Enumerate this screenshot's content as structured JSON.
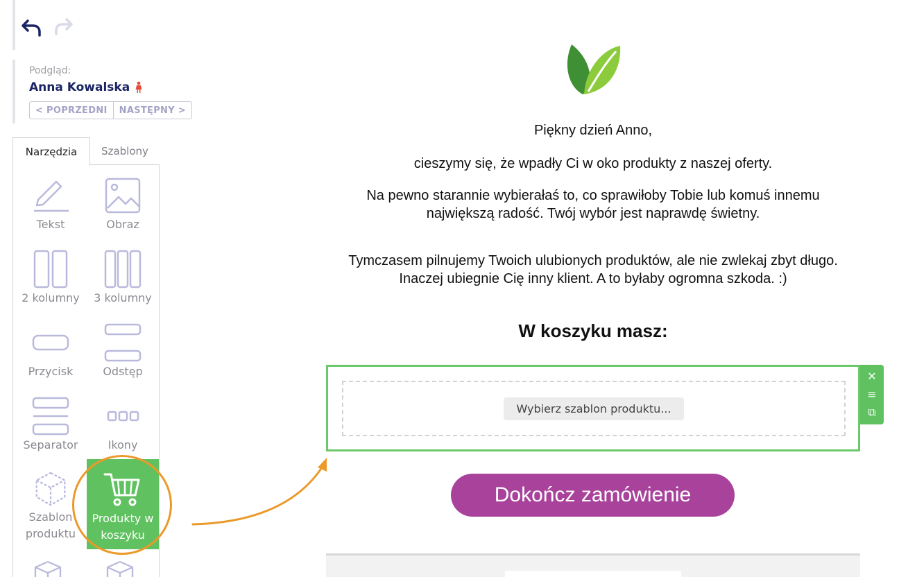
{
  "toolbar": {
    "undo_icon": "undo-icon",
    "redo_icon": "redo-icon"
  },
  "preview": {
    "label": "Podgląd:",
    "recipient": "Anna Kowalska",
    "prev_label": "< POPRZEDNI",
    "next_label": "NASTĘPNY >"
  },
  "tabs": {
    "tools": "Narzędzia",
    "templates": "Szablony"
  },
  "tools": [
    {
      "id": "text",
      "label": "Tekst",
      "icon": "pencil-icon"
    },
    {
      "id": "image",
      "label": "Obraz",
      "icon": "image-icon"
    },
    {
      "id": "two-columns",
      "label": "2 kolumny",
      "icon": "two-columns-icon"
    },
    {
      "id": "three-columns",
      "label": "3 kolumny",
      "icon": "three-columns-icon"
    },
    {
      "id": "button",
      "label": "Przycisk",
      "icon": "button-icon"
    },
    {
      "id": "spacer",
      "label": "Odstęp",
      "icon": "spacer-icon"
    },
    {
      "id": "separator",
      "label": "Separator",
      "icon": "separator-icon"
    },
    {
      "id": "icons",
      "label": "Ikony",
      "icon": "icons-icon"
    },
    {
      "id": "product-template",
      "label": "Szablon produktu",
      "icon": "box-icon"
    },
    {
      "id": "cart-products",
      "label": "Produkty w koszyku",
      "icon": "cart-icon"
    }
  ],
  "email": {
    "greeting": "Piękny dzień Anno,",
    "line1": "cieszymy się, że wpadły Ci w oko produkty z naszej oferty.",
    "line2a": "Na pewno starannie wybierałaś to, co sprawiłoby Tobie lub komuś innemu",
    "line2b": "największą radość. Twój wybór jest naprawdę świetny.",
    "line3a": "Tymczasem pilnujemy Twoich ulubionych produktów, ale nie zwlekaj zbyt długo.",
    "line3b": "Inaczej ubiegnie Cię inny klient. A to byłaby ogromna szkoda. :)",
    "cart_heading": "W koszyku masz:",
    "product_select": "Wybierz szablon produktu...",
    "cta": "Dokończ zamówienie"
  },
  "block_actions": {
    "close": "✕",
    "menu": "≡",
    "copy": "⧉"
  },
  "colors": {
    "accent_green": "#5fc15f",
    "cta_purple": "#a8429b",
    "highlight_orange": "#eb9a2a",
    "navy": "#1b2563"
  }
}
